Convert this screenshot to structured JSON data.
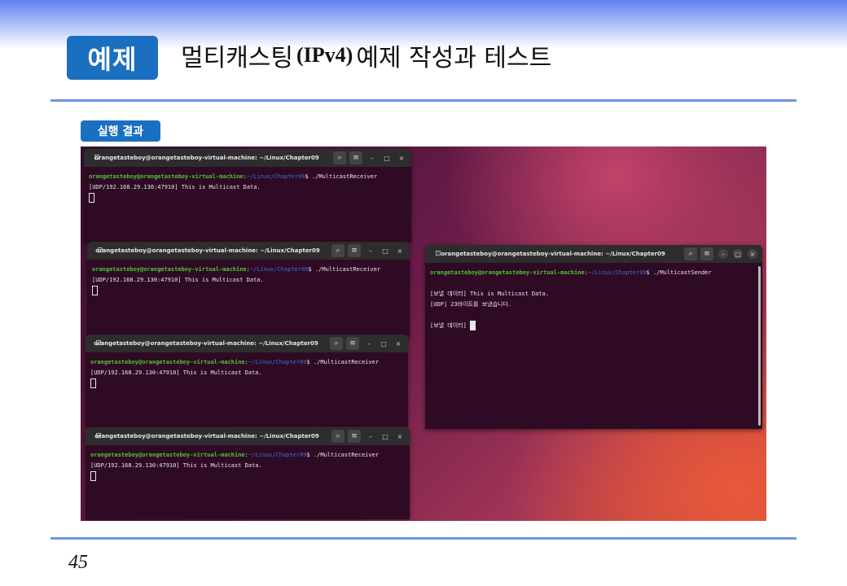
{
  "slide": {
    "badge": "예제",
    "title_pre": "멀티캐스팅",
    "title_mid": "(IPv4)",
    "title_post": "예제 작성과 테스트",
    "section_label": "실행 결과",
    "page_number": "45"
  },
  "terminal_common": {
    "window_title": "orangetasteboy@orangetasteboy-virtual-machine: ~/Linux/Chapter09",
    "prompt_user": "orangetasteboy@orangetasteboy-virtual-machine",
    "prompt_sep": ":",
    "prompt_path": "~/Linux/Chapter09",
    "prompt_symbol": "$ "
  },
  "receivers": [
    {
      "command": "./MulticastReceiver",
      "output": "[UDP/192.168.29.130:47910] This is Multicast Data."
    },
    {
      "command": "./MulticastReceiver",
      "output": "[UDP/192.168.29.130:47910] This is Multicast Data."
    },
    {
      "command": "./MulticastReceiver",
      "output": "[UDP/192.168.29.130:47910] This is Multicast Data."
    },
    {
      "command": "./MulticastReceiver",
      "output": "[UDP/192.168.29.130:47910] This is Multicast Data."
    }
  ],
  "sender": {
    "command": "./MulticastSender",
    "line1": "[보낼 데이터] This is Multicast Data.",
    "line2": "[UDP] 23바이트를 보냈습니다.",
    "line3": "[보낼 데이터] "
  },
  "icons": {
    "new_tab": "new-tab-icon",
    "search": "search-icon",
    "menu": "hamburger-menu-icon",
    "minimize": "minimize-icon",
    "maximize": "maximize-icon",
    "close": "close-icon"
  }
}
